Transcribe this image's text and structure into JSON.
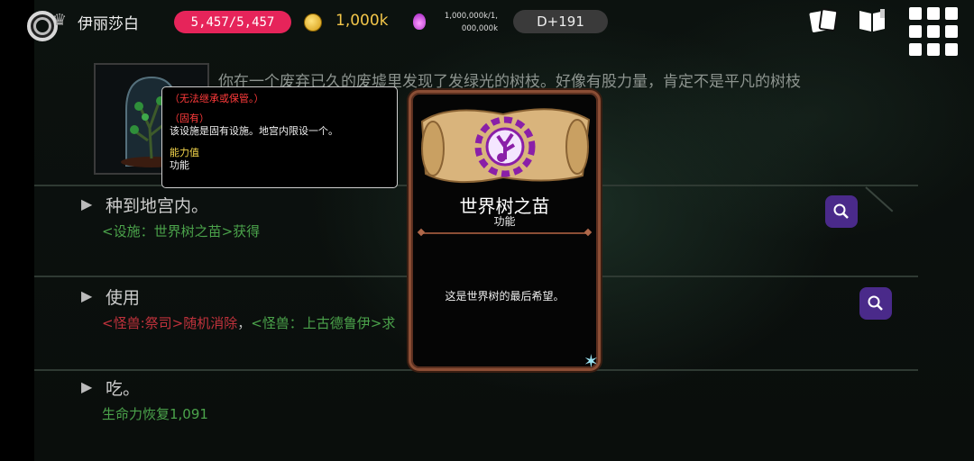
{
  "topbar": {
    "player_name": "伊丽莎白",
    "hp": "5,457/5,457",
    "gold": "1,000k",
    "soul_line1": "1,000,000k/1,",
    "soul_line2": "000,000k",
    "day": "D+191"
  },
  "item": {
    "description": "你在一个废弃已久的废墟里发现了发绿光的树枝。好像有股力量，肯定不是平凡的树枝"
  },
  "sections": [
    {
      "title": "种到地宫内。",
      "sub_prefix": "<设施：世界树之苗>获得"
    },
    {
      "title": "使用",
      "sub_red": "<怪兽:祭司>随机消除",
      "sub_sep": "，",
      "sub_green": "<怪兽：上古德鲁伊>求"
    },
    {
      "title": "吃。",
      "sub_prefix": "生命力恢复1,091"
    }
  ],
  "tooltip": {
    "line1": "（无法继承或保管。）",
    "line2": "（固有）",
    "line3": "该设施是固有设施。地宫内限设一个。",
    "line4": "能力值",
    "line5": "功能"
  },
  "card": {
    "title": "世界树之苗",
    "subtitle": "功能",
    "description": "这是世界树的最后希望。"
  },
  "colors": {
    "hp_pill": "#e6245a",
    "gold": "#f3c64a",
    "green_text": "#4ba34b",
    "red_text": "#c0323c",
    "search_button": "#4a2a8a",
    "card_border": "#8b4e35"
  },
  "icons": [
    "ring-icon",
    "crown-icon",
    "coin-icon",
    "soul-flame-icon",
    "cards-icon",
    "book-icon",
    "grid-menu-icon",
    "search-icon",
    "scroll-emblem-icon",
    "star-icon",
    "arrow-right-icon"
  ]
}
